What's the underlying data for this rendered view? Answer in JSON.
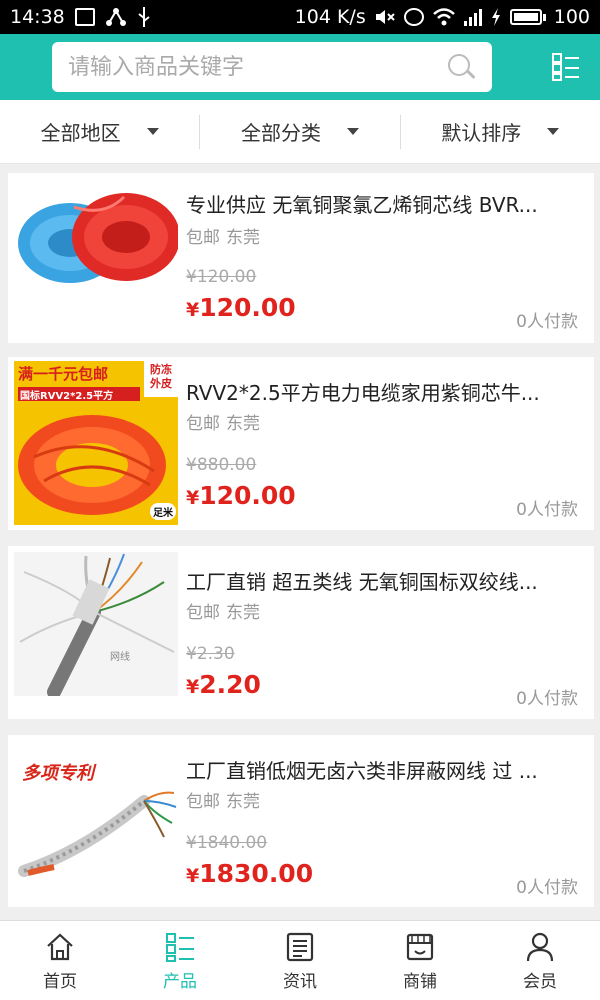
{
  "status": {
    "time": "14:38",
    "speed": "104 K/s",
    "battery": "100"
  },
  "search": {
    "placeholder": "请输入商品关键字"
  },
  "filters": [
    {
      "label": "全部地区"
    },
    {
      "label": "全部分类"
    },
    {
      "label": "默认排序"
    }
  ],
  "currency": "¥",
  "products": [
    {
      "title": "专业供应 无氧铜聚氯乙烯铜芯线 BVR...",
      "shipping": "包邮",
      "location": "东莞",
      "old_price": "¥120.00",
      "price": "120.00",
      "sold": "0人付款"
    },
    {
      "title": "RVV2*2.5平方电力电缆家用紫铜芯牛...",
      "shipping": "包邮",
      "location": "东莞",
      "old_price": "¥880.00",
      "price": "120.00",
      "sold": "0人付款",
      "image_text": {
        "top": "满一千元包邮",
        "sub": "国标RVV2*2.5平方",
        "corner": "防冻外皮",
        "badge": "足米"
      }
    },
    {
      "title": "工厂直销 超五类线 无氧铜国标双绞线...",
      "shipping": "包邮",
      "location": "东莞",
      "old_price": "¥2.30",
      "price": "2.20",
      "sold": "0人付款",
      "image_text": {
        "watermark": "网线"
      }
    },
    {
      "title": "工厂直销低烟无卤六类非屏蔽网线 过 ...",
      "shipping": "包邮",
      "location": "东莞",
      "old_price": "¥1840.00",
      "price": "1830.00",
      "sold": "0人付款",
      "image_text": {
        "top": "多项专利"
      }
    }
  ],
  "tabs": [
    {
      "label": "首页",
      "icon": "home-icon"
    },
    {
      "label": "产品",
      "icon": "product-list-icon"
    },
    {
      "label": "资讯",
      "icon": "news-icon"
    },
    {
      "label": "商铺",
      "icon": "store-icon"
    },
    {
      "label": "会员",
      "icon": "member-icon"
    }
  ],
  "colors": {
    "accent": "#20c0b0",
    "price": "#e0231c"
  }
}
